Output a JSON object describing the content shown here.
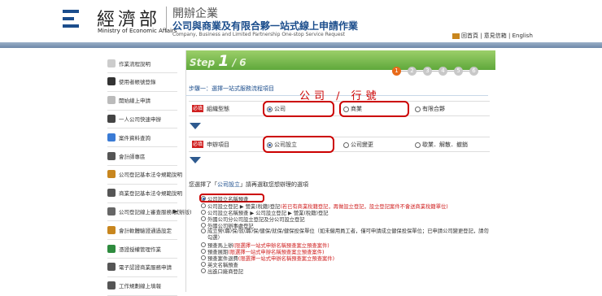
{
  "header": {
    "org_zh": "經濟部",
    "org_en": "Ministry of Economic Affairs",
    "title_main": "開辦企業",
    "title_sub": "公司與商業及有限合夥一站式線上申請作業",
    "title_en": "Company, Business and Limited Partnership One-stop Service Request",
    "links": "回首頁 | 意見信箱 | English"
  },
  "sidebar": [
    {
      "label": "作業流程說明",
      "icon": "info-icon",
      "color": "#cccccc"
    },
    {
      "label": "使用者帳號登錄",
      "icon": "key-icon",
      "color": "#333333"
    },
    {
      "label": "開始線上申請",
      "icon": "document-icon",
      "color": "#bbbbbb"
    },
    {
      "label": "一人公司快速申辦",
      "icon": "pen-icon",
      "color": "#444444"
    },
    {
      "label": "案件資料查詢",
      "icon": "search-icon",
      "color": "#3a7bd5"
    },
    {
      "label": "會計師專區",
      "icon": "ledger-icon",
      "color": "#555555"
    },
    {
      "label": "公司登記基本法令規範說明",
      "icon": "money-bag-icon",
      "color": "#c8861e"
    },
    {
      "label": "商業登記基本法令規範說明",
      "icon": "money-bag-icon",
      "color": "#555555"
    },
    {
      "label": "公司登記線上審查服務(試辦版)",
      "icon": "laptop-icon",
      "color": "#666666"
    },
    {
      "label": "會計軟體驗證通過設定",
      "icon": "software-icon",
      "color": "#c8861e"
    },
    {
      "label": "憑證授權管理作業",
      "icon": "shield-icon",
      "color": "#2e8b3e"
    },
    {
      "label": "電子認證商業服務申請",
      "icon": "email-icon",
      "color": "#555555"
    },
    {
      "label": "工作規劃線上填報",
      "icon": "pencil-icon",
      "color": "#555555"
    }
  ],
  "step": {
    "prefix": "Step",
    "current": "1",
    "sep": "/",
    "total": "6"
  },
  "progress": [
    "1",
    "2",
    "3",
    "4",
    "5",
    "6"
  ],
  "section_title": "步驟一：選擇一站式服務流程項目",
  "annotation": "公司 / 行號",
  "row1": {
    "required": "必填",
    "label": "組織型態",
    "options": [
      "公司",
      "商業",
      "有限合夥"
    ]
  },
  "row2": {
    "required": "必填",
    "label": "申辦項目",
    "options": [
      "公司設立",
      "公司變更",
      "歇業．解散．撤銷"
    ]
  },
  "selection_prefix": "您選擇了「",
  "selection_link": "公司設立",
  "selection_suffix": "」請再選取您想辦理的選項",
  "items": [
    {
      "text": "公司設立名稱預查",
      "note": ""
    },
    {
      "text": "公司設立登記 ▶ 營業(稅籍)登記",
      "note": "(若已有商業稅籍登記，再做設立登記，設立登記案件不會送商業稅籍單位)"
    },
    {
      "text": "公司設立名稱預查 ▶ 公司設立登記 ▶ 營業(稅籍)登記",
      "note": ""
    },
    {
      "text": "外國公司分公司設立登記及分公司設立登記",
      "note": ""
    },
    {
      "text": "外國公司辦事處登記",
      "note": ""
    },
    {
      "text": "成立勞(職)保/就(職)保/健保/就保/健保投保單位（如未僱用員工者，僅可申請成立健保投保單位；已申請公司變更登記，請勿勾選）",
      "note": ""
    },
    {
      "text": "預查馬上辦",
      "note": "(限選擇一站式申辦名稱預查案立預查案件)"
    },
    {
      "text": "預查展期",
      "note": "(限選擇一站式申辦名稱預查案立預查案件)"
    },
    {
      "text": "預查案件退費",
      "note": "(限選擇一站式申辦名稱預查案立預查案件)"
    },
    {
      "text": "英文名稱預查",
      "note": ""
    },
    {
      "text": "出進口廠商登記",
      "note": ""
    }
  ]
}
